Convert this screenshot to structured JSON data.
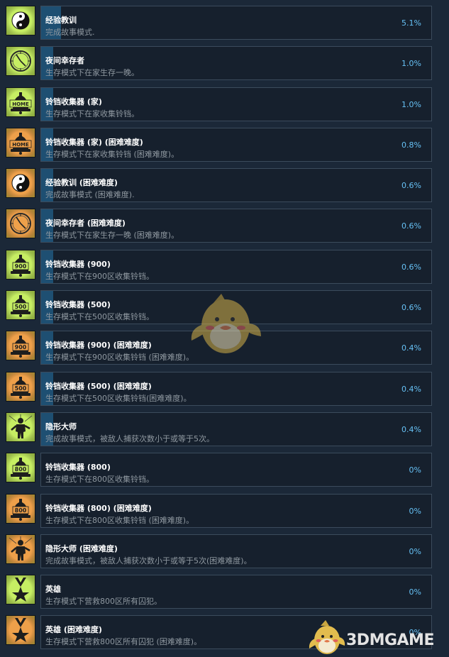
{
  "achievements": [
    {
      "title": "经验教训",
      "desc": "完成故事模式.",
      "percent": "5.1%",
      "progress": 5.1,
      "icon": "yin-yang-icon",
      "hard": false
    },
    {
      "title": "夜间幸存者",
      "desc": "生存模式下在家生存一晚。",
      "percent": "1.0%",
      "progress": 1.0,
      "icon": "clock-icon",
      "hard": false
    },
    {
      "title": "铃铛收集器 (家)",
      "desc": "生存模式下在家收集铃铛。",
      "percent": "1.0%",
      "progress": 1.0,
      "icon": "bell-icon",
      "bell_label": "HOME",
      "hard": false
    },
    {
      "title": "铃铛收集器 (家) (困难难度)",
      "desc": "生存模式下在家收集铃铛 (困难难度)。",
      "percent": "0.8%",
      "progress": 0.8,
      "icon": "bell-icon",
      "bell_label": "HOME",
      "hard": true
    },
    {
      "title": "经验教训 (困难难度)",
      "desc": "完成故事模式 (困难难度).",
      "percent": "0.6%",
      "progress": 0.6,
      "icon": "yin-yang-icon",
      "hard": true
    },
    {
      "title": "夜间幸存者 (困难难度)",
      "desc": "生存模式下在家生存一晚 (困难难度)。",
      "percent": "0.6%",
      "progress": 0.6,
      "icon": "clock-icon",
      "hard": true
    },
    {
      "title": "铃铛收集器 (900)",
      "desc": "生存模式下在900区收集铃铛。",
      "percent": "0.6%",
      "progress": 0.6,
      "icon": "bell-icon",
      "bell_label": "900",
      "hard": false
    },
    {
      "title": "铃铛收集器 (500)",
      "desc": "生存模式下在500区收集铃铛。",
      "percent": "0.6%",
      "progress": 0.6,
      "icon": "bell-icon",
      "bell_label": "500",
      "hard": false
    },
    {
      "title": "铃铛收集器 (900) (困难难度)",
      "desc": "生存模式下在900区收集铃铛 (困难难度)。",
      "percent": "0.4%",
      "progress": 0.4,
      "icon": "bell-icon",
      "bell_label": "900",
      "hard": true
    },
    {
      "title": "铃铛收集器 (500) (困难难度)",
      "desc": "生存模式下在500区收集铃铛(困难难度)。",
      "percent": "0.4%",
      "progress": 0.4,
      "icon": "bell-icon",
      "bell_label": "500",
      "hard": true
    },
    {
      "title": "隐形大师",
      "desc": "完成故事模式，被敌人捕获次数小于或等于5次。",
      "percent": "0.4%",
      "progress": 0.4,
      "icon": "stealth-figure-icon",
      "hard": false
    },
    {
      "title": "铃铛收集器 (800)",
      "desc": "生存模式下在800区收集铃铛。",
      "percent": "0%",
      "progress": 0,
      "icon": "bell-icon",
      "bell_label": "800",
      "hard": false
    },
    {
      "title": "铃铛收集器 (800) (困难难度)",
      "desc": "生存模式下在800区收集铃铛 (困难难度)。",
      "percent": "0%",
      "progress": 0,
      "icon": "bell-icon",
      "bell_label": "800",
      "hard": true
    },
    {
      "title": "隐形大师 (困难难度)",
      "desc": "完成故事模式，被敌人捕获次数小于或等于5次(困难难度)。",
      "percent": "0%",
      "progress": 0,
      "icon": "stealth-figure-icon",
      "hard": true
    },
    {
      "title": "英雄",
      "desc": "生存模式下营救800区所有囚犯。",
      "percent": "0%",
      "progress": 0,
      "icon": "medal-icon",
      "hard": false
    },
    {
      "title": "英雄 (困难难度)",
      "desc": "生存模式下营救800区所有囚犯 (困难难度)。",
      "percent": "0%",
      "progress": 0,
      "icon": "medal-icon",
      "hard": true
    }
  ],
  "watermark": {
    "text": "3DMGAME"
  },
  "colors": {
    "background": "#1b2838",
    "card": "#16202d",
    "card_border": "#3b4b5c",
    "progress_fill": "#1e4f72",
    "percent": "#66c0f4",
    "icon_normal": "#c6ee63",
    "icon_hard": "#eea04a"
  }
}
